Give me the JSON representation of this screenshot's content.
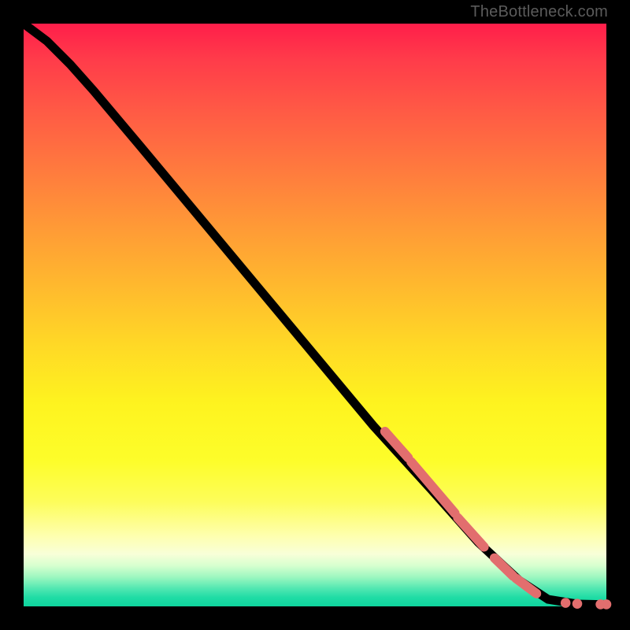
{
  "watermark": "TheBottleneck.com",
  "chart_data": {
    "type": "line",
    "title": "",
    "xlabel": "",
    "ylabel": "",
    "xlim": [
      0,
      100
    ],
    "ylim": [
      0,
      100
    ],
    "curve": [
      {
        "x": 0,
        "y": 100
      },
      {
        "x": 4,
        "y": 97
      },
      {
        "x": 8,
        "y": 93
      },
      {
        "x": 12,
        "y": 88.5
      },
      {
        "x": 20,
        "y": 79
      },
      {
        "x": 30,
        "y": 67
      },
      {
        "x": 40,
        "y": 55
      },
      {
        "x": 50,
        "y": 43
      },
      {
        "x": 60,
        "y": 31
      },
      {
        "x": 70,
        "y": 20
      },
      {
        "x": 78,
        "y": 11
      },
      {
        "x": 85,
        "y": 4.5
      },
      {
        "x": 90,
        "y": 1.2
      },
      {
        "x": 95,
        "y": 0.4
      },
      {
        "x": 100,
        "y": 0.3
      }
    ],
    "highlight_segments": [
      {
        "x1": 62,
        "y1": 30,
        "x2": 66,
        "y2": 25.5
      },
      {
        "x1": 66.5,
        "y1": 24.8,
        "x2": 74,
        "y2": 16
      },
      {
        "x1": 74.5,
        "y1": 15.2,
        "x2": 79,
        "y2": 10.2
      },
      {
        "x1": 80.8,
        "y1": 8.3,
        "x2": 84,
        "y2": 5.2
      },
      {
        "x1": 84.5,
        "y1": 4.8,
        "x2": 88,
        "y2": 2.2
      }
    ],
    "highlight_points": [
      {
        "x": 93,
        "y": 0.6
      },
      {
        "x": 95,
        "y": 0.45
      },
      {
        "x": 99,
        "y": 0.35
      },
      {
        "x": 100,
        "y": 0.35
      }
    ]
  }
}
